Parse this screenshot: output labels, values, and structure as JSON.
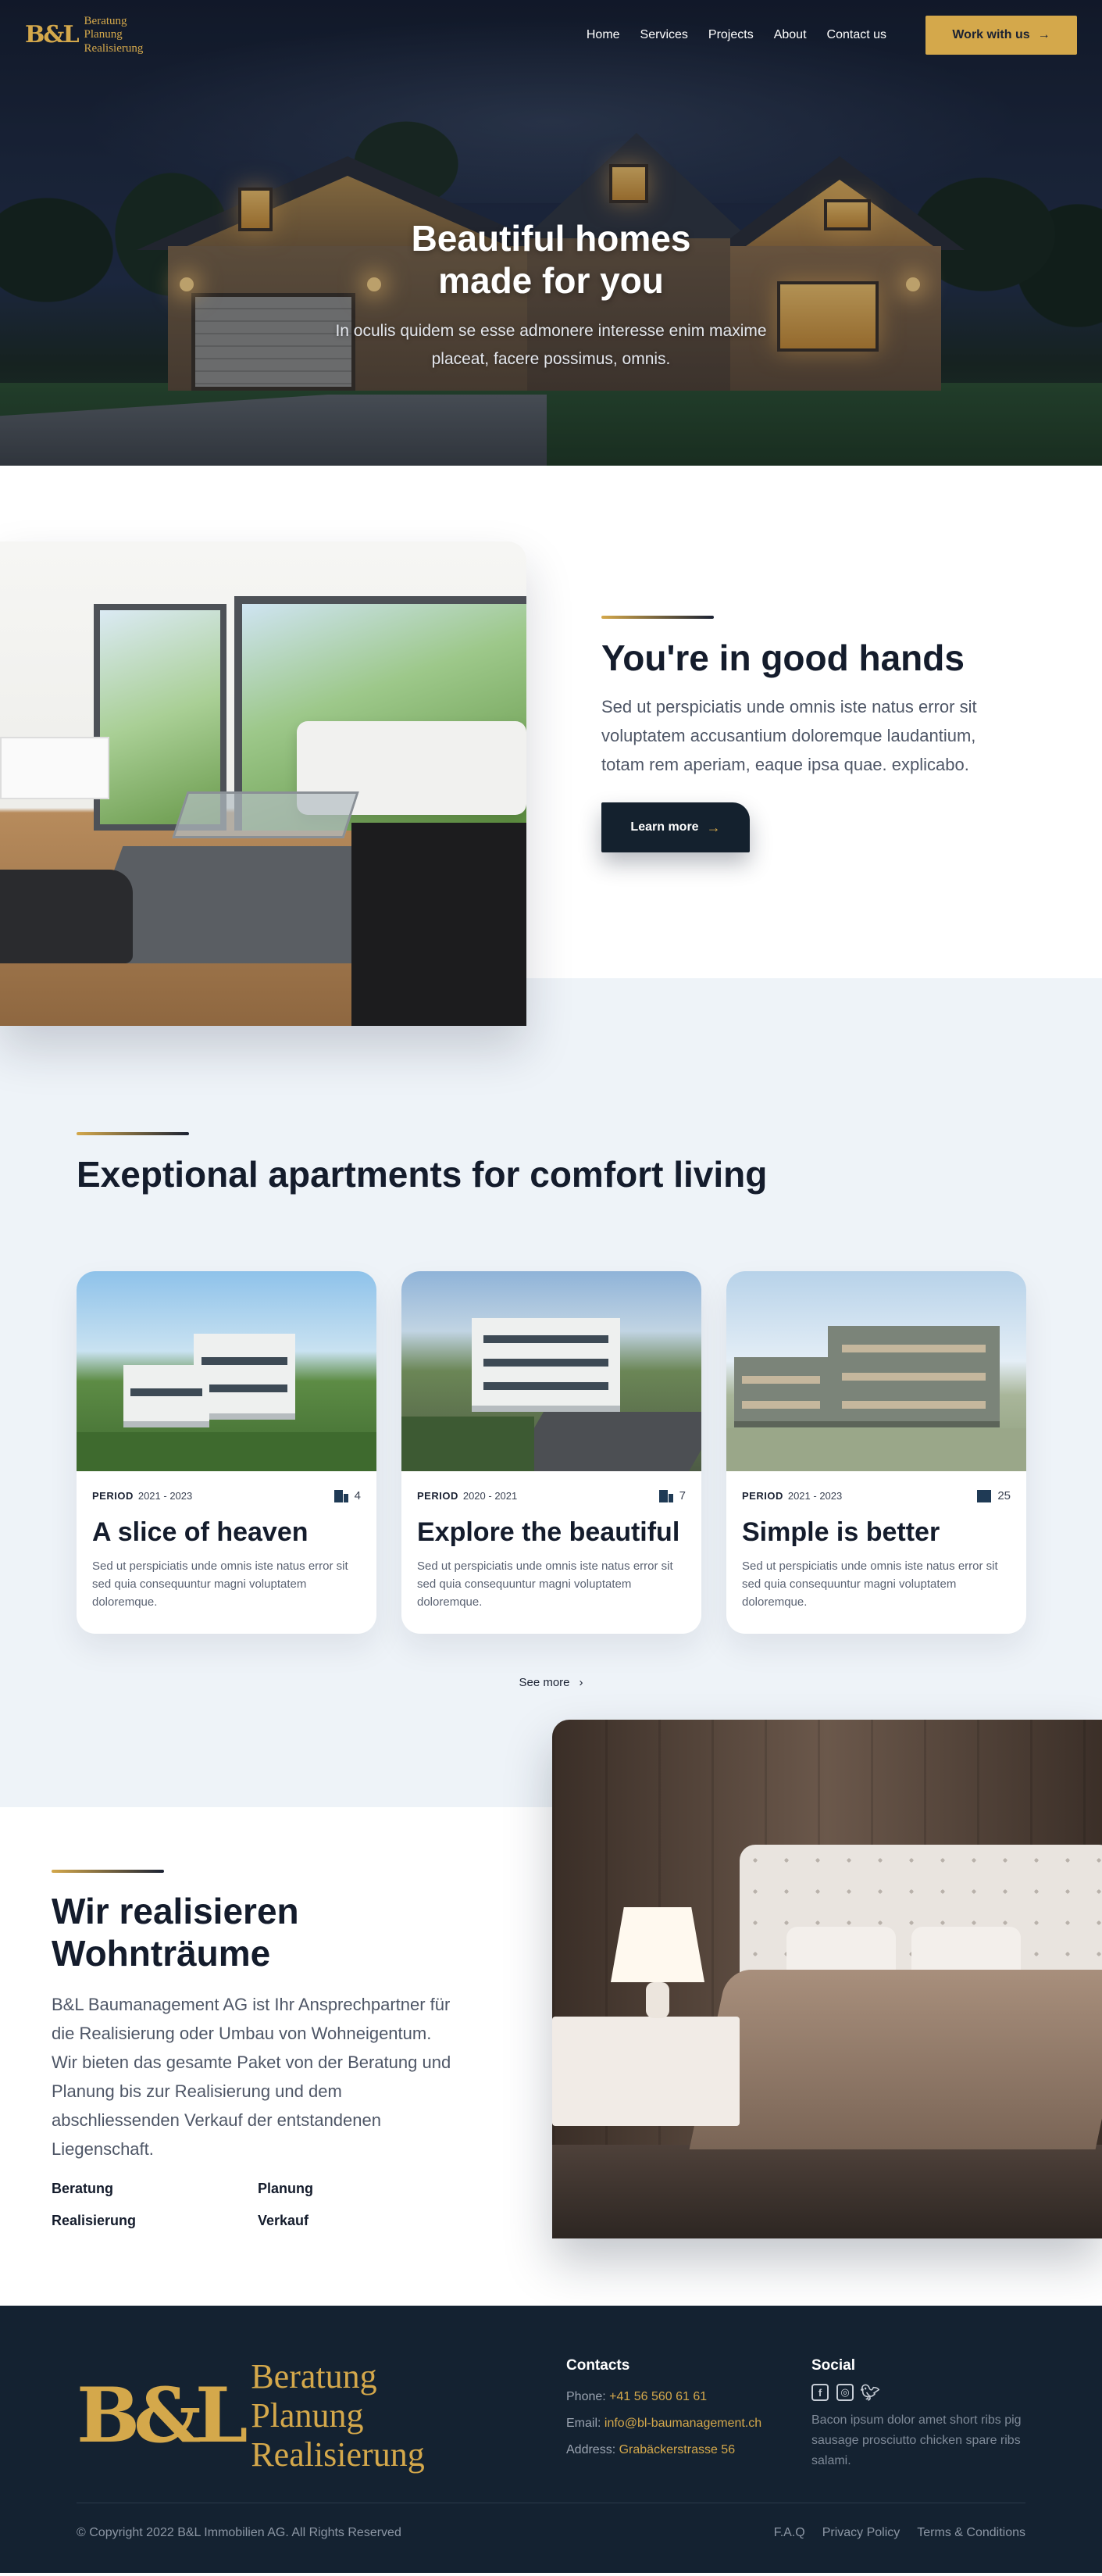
{
  "brand": {
    "mark": "B&L",
    "lines": [
      "Beratung",
      "Planung",
      "Realisierung"
    ],
    "accent_color": "#d4a84b",
    "dark_color": "#142231"
  },
  "nav": {
    "links": [
      "Home",
      "Services",
      "Projects",
      "About",
      "Contact us"
    ],
    "cta_label": "Work with us",
    "cta_icon": "arrow-right-icon"
  },
  "hero": {
    "title": "Beautiful homes made for you",
    "subtitle": "In oculis quidem se esse admonere interesse enim maxime placeat, facere possimus, omnis."
  },
  "hands": {
    "title": "You're in good hands",
    "body": "Sed ut perspiciatis unde omnis iste natus error sit voluptatem accusantium doloremque laudantium, totam rem aperiam, eaque ipsa quae. explicabo.",
    "button_label": "Learn more"
  },
  "apartments": {
    "title": "Exeptional apartments for comfort living",
    "see_more": "See more",
    "cards": [
      {
        "period_label": "PERIOD",
        "period": "2021 - 2023",
        "count": "4",
        "title": "A slice of heaven",
        "desc": "Sed ut perspiciatis unde omnis iste natus error sit sed quia consequuntur magni voluptatem doloremque."
      },
      {
        "period_label": "PERIOD",
        "period": "2020 - 2021",
        "count": "7",
        "title": "Explore the beautiful",
        "desc": "Sed ut perspiciatis unde omnis iste natus error sit sed quia consequuntur magni voluptatem doloremque."
      },
      {
        "period_label": "PERIOD",
        "period": "2021 - 2023",
        "count": "25",
        "title": "Simple is better",
        "desc": "Sed ut perspiciatis unde omnis iste natus error sit sed quia consequuntur magni voluptatem doloremque."
      }
    ]
  },
  "wir": {
    "title": "Wir realisieren Wohnträume",
    "body": "B&L Baumanagement AG ist Ihr Ansprechpartner für die Realisierung oder Umbau von Wohneigentum. Wir bieten das gesamte Paket von der Beratung und Planung bis zur Realisierung und dem abschliessenden Verkauf der entstandenen Liegenschaft.",
    "services": [
      "Beratung",
      "Planung",
      "Realisierung",
      "Verkauf"
    ]
  },
  "footer": {
    "contacts_title": "Contacts",
    "phone_label": "Phone:",
    "phone": "+41 56 560 61 61",
    "email_label": "Email:",
    "email": "info@bl-baumanagement.ch",
    "address_label": "Address:",
    "address": "Grabäckerstrasse 56",
    "social_title": "Social",
    "social_icons": [
      "facebook-icon",
      "instagram-icon",
      "twitter-icon"
    ],
    "social_text": "Bacon ipsum dolor amet short ribs pig sausage prosciutto chicken spare ribs salami.",
    "copyright": "© Copyright 2022 B&L Immobilien AG. All Rights Reserved",
    "legal_links": [
      "F.A.Q",
      "Privacy Policy",
      "Terms & Conditions"
    ]
  }
}
